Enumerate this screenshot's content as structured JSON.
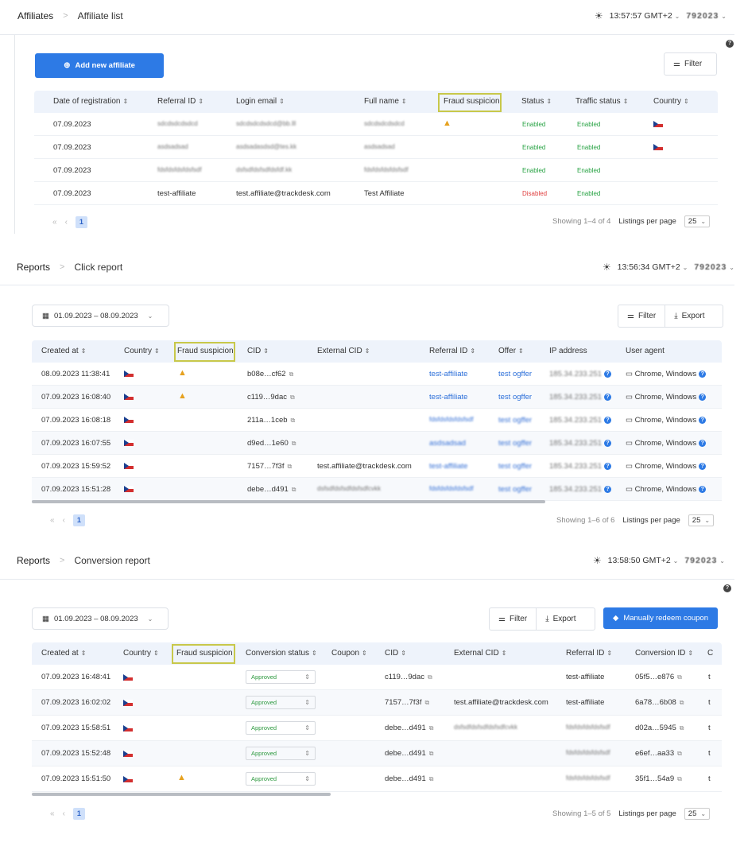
{
  "affiliates": {
    "breadcrumb": {
      "section": "Affiliates",
      "page": "Affiliate list"
    },
    "time": "13:57:57 GMT+2",
    "workspace": "792023",
    "add_button": "Add new affiliate",
    "filter_button": "Filter",
    "columns": [
      "Date of registration",
      "Referral ID",
      "Login email",
      "Full name",
      "Fraud suspicion",
      "Status",
      "Traffic status",
      "Country"
    ],
    "rows": [
      {
        "date": "07.09.2023",
        "ref": "sdcdsdcdsdcd",
        "email": "sdcdsdcdsdcd@bb.lll",
        "name": "sdcdsdcdsdcd",
        "status": "Enabled",
        "traffic": "Enabled"
      },
      {
        "date": "07.09.2023",
        "ref": "asdsadsad",
        "email": "asdsadasdsd@tes.kk",
        "name": "asdsadsad",
        "status": "Enabled",
        "traffic": "Enabled"
      },
      {
        "date": "07.09.2023",
        "ref": "fdsfdsfdsfdsfsdf",
        "email": "dsfsdfdsfsdfdsfdf.kk",
        "name": "fdsfdsfdsfdsfsdf",
        "status": "Enabled",
        "traffic": "Enabled"
      },
      {
        "date": "07.09.2023",
        "ref": "test-affiliate",
        "email": "test.affiliate@trackdesk.com",
        "name": "Test Affiliate",
        "status": "Disabled",
        "traffic": "Enabled"
      }
    ],
    "page": "1",
    "showing": "Showing 1–4 of 4",
    "listings_label": "Listings per page",
    "per_page": "25"
  },
  "clicks": {
    "breadcrumb": {
      "section": "Reports",
      "page": "Click report"
    },
    "time": "13:56:34 GMT+2",
    "workspace": "792023",
    "date_range": "01.09.2023 – 08.09.2023",
    "filter_button": "Filter",
    "export_button": "Export",
    "columns": [
      "Created at",
      "Country",
      "Fraud suspicion",
      "CID",
      "External CID",
      "Referral ID",
      "Offer",
      "IP address",
      "User agent"
    ],
    "rows": [
      {
        "created": "08.09.2023 11:38:41",
        "cid": "b08e…cf62",
        "ext": "",
        "ref": "test-affiliate",
        "offer": "test ogffer",
        "ip": "185.34.233.251",
        "ua": "Chrome, Windows"
      },
      {
        "created": "07.09.2023 16:08:40",
        "cid": "c119…9dac",
        "ext": "",
        "ref": "test-affiliate",
        "offer": "test ogffer",
        "ip": "185.34.233.251",
        "ua": "Chrome, Windows"
      },
      {
        "created": "07.09.2023 16:08:18",
        "cid": "211a…1ceb",
        "ext": "",
        "ref": "fdsfdsfdsfdsfsdf",
        "offer": "test ogffer",
        "ip": "185.34.233.251",
        "ua": "Chrome, Windows"
      },
      {
        "created": "07.09.2023 16:07:55",
        "cid": "d9ed…1e60",
        "ext": "",
        "ref": "asdsadsad",
        "offer": "test ogffer",
        "ip": "185.34.233.251",
        "ua": "Chrome, Windows"
      },
      {
        "created": "07.09.2023 15:59:52",
        "cid": "7157…7f3f",
        "ext": "test.affiliate@trackdesk.com",
        "ref": "test-affiliate",
        "offer": "test ogffer",
        "ip": "185.34.233.251",
        "ua": "Chrome, Windows"
      },
      {
        "created": "07.09.2023 15:51:28",
        "cid": "debe…d491",
        "ext": "dsfsdfdsfsdfdsfsdfcvkk",
        "ref": "fdsfdsfdsfdsfsdf",
        "offer": "test ogffer",
        "ip": "185.34.233.251",
        "ua": "Chrome, Windows"
      }
    ],
    "page": "1",
    "showing": "Showing 1–6 of 6",
    "listings_label": "Listings per page",
    "per_page": "25"
  },
  "conversions": {
    "breadcrumb": {
      "section": "Reports",
      "page": "Conversion report"
    },
    "time": "13:58:50 GMT+2",
    "workspace": "792023",
    "date_range": "01.09.2023 – 08.09.2023",
    "filter_button": "Filter",
    "export_button": "Export",
    "redeem_button": "Manually redeem coupon",
    "columns": [
      "Created at",
      "Country",
      "Fraud suspicion",
      "Conversion status",
      "Coupon",
      "CID",
      "External CID",
      "Referral ID",
      "Conversion ID"
    ],
    "rows": [
      {
        "created": "07.09.2023 16:48:41",
        "status": "Approved",
        "cid": "c119…9dac",
        "ext": "",
        "ref": "test-affiliate",
        "conv": "05f5…e876"
      },
      {
        "created": "07.09.2023 16:02:02",
        "status": "Approved",
        "cid": "7157…7f3f",
        "ext": "test.affiliate@trackdesk.com",
        "ref": "test-affiliate",
        "conv": "6a78…6b08"
      },
      {
        "created": "07.09.2023 15:58:51",
        "status": "Approved",
        "cid": "debe…d491",
        "ext": "dsfsdfdsfsdfdsfsdfcvkk",
        "ref": "fdsfdsfdsfdsfsdf",
        "conv": "d02a…5945"
      },
      {
        "created": "07.09.2023 15:52:48",
        "status": "Approved",
        "cid": "debe…d491",
        "ext": "",
        "ref": "fdsfdsfdsfdsfsdf",
        "conv": "e6ef…aa33"
      },
      {
        "created": "07.09.2023 15:51:50",
        "status": "Approved",
        "cid": "debe…d491",
        "ext": "",
        "ref": "fdsfdsfdsfdsfsdf",
        "conv": "35f1…54a9"
      }
    ],
    "page": "1",
    "showing": "Showing 1–5 of 5",
    "listings_label": "Listings per page",
    "per_page": "25"
  }
}
